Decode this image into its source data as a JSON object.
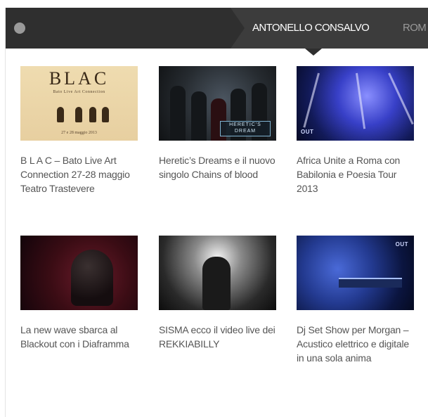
{
  "header": {
    "tabs": [
      {
        "label": "ANTONELLO CONSALVO",
        "active": true
      },
      {
        "label": "ROM",
        "active": false
      }
    ]
  },
  "thumbnails": {
    "blac_title": "BLAC",
    "blac_subtitle": "Bato Live Art Connection",
    "blac_date": "27 e 28 maggio 2013",
    "heretic_badge": "HERETIC'S DREAM",
    "outdoors_logo": "OUT"
  },
  "posts": [
    {
      "title": "B L A C – Bato Live Art Connection 27-28 maggio Teatro Trastevere"
    },
    {
      "title": "Heretic’s Dreams e il nuovo singolo Chains of blood"
    },
    {
      "title": "Africa Unite a Roma con Babilonia e Poesia Tour 2013"
    },
    {
      "title": "La new wave sbarca al Blackout con i Diaframma"
    },
    {
      "title": "SISMA ecco il video live dei REKKIABILLY"
    },
    {
      "title": "Dj Set Show per Morgan – Acustico elettrico e digitale in una sola anima"
    }
  ]
}
